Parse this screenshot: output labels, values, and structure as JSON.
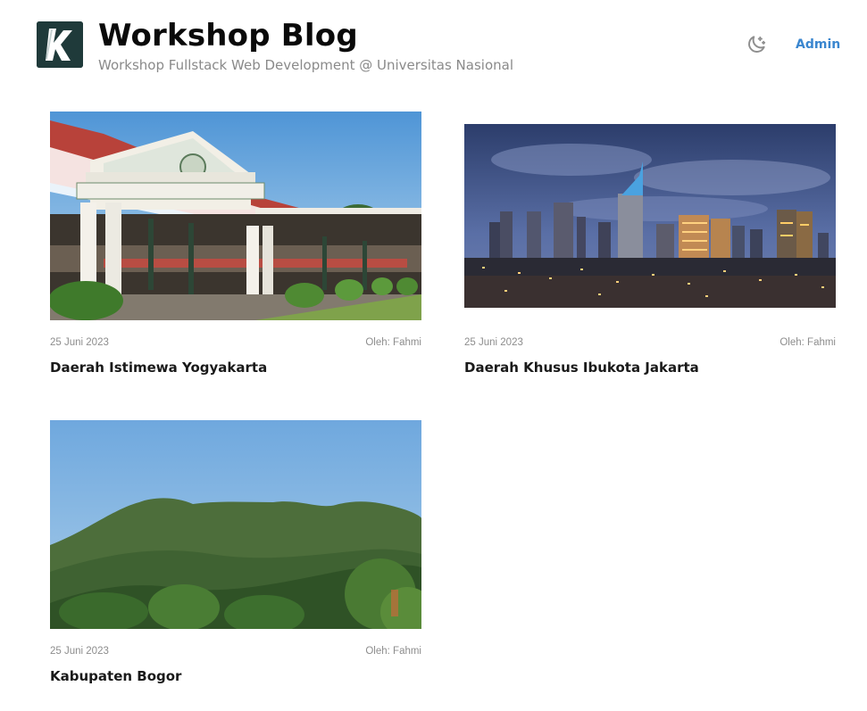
{
  "site": {
    "title": "Workshop Blog",
    "subtitle": "Workshop Fullstack Web Development @ Universitas Nasional",
    "logo_letter": "K",
    "logo_icon": "k-logo-icon"
  },
  "nav": {
    "theme_toggle_icon": "moon-icon",
    "admin_label": "Admin"
  },
  "posts": [
    {
      "date": "25 Juni 2023",
      "author": "Oleh: Fahmi",
      "title": "Daerah Istimewa Yogyakarta",
      "image_icon": "keraton-yogyakarta-image"
    },
    {
      "date": "25 Juni 2023",
      "author": "Oleh: Fahmi",
      "title": "Daerah Khusus Ibukota Jakarta",
      "image_icon": "jakarta-skyline-image"
    },
    {
      "date": "25 Juni 2023",
      "author": "Oleh: Fahmi",
      "title": "Kabupaten Bogor",
      "image_icon": "bogor-mountain-image"
    }
  ],
  "colors": {
    "accent": "#3a86cf",
    "muted": "#8a8a8a",
    "logo_bg": "#1f3a3a"
  }
}
